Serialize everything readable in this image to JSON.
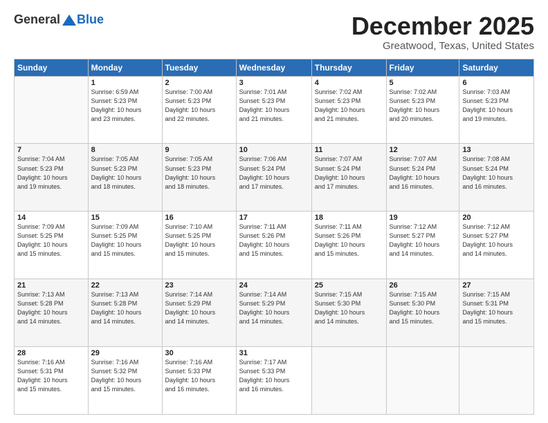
{
  "header": {
    "logo_general": "General",
    "logo_blue": "Blue",
    "month": "December 2025",
    "location": "Greatwood, Texas, United States"
  },
  "weekdays": [
    "Sunday",
    "Monday",
    "Tuesday",
    "Wednesday",
    "Thursday",
    "Friday",
    "Saturday"
  ],
  "weeks": [
    [
      {
        "day": "",
        "info": ""
      },
      {
        "day": "1",
        "info": "Sunrise: 6:59 AM\nSunset: 5:23 PM\nDaylight: 10 hours\nand 23 minutes."
      },
      {
        "day": "2",
        "info": "Sunrise: 7:00 AM\nSunset: 5:23 PM\nDaylight: 10 hours\nand 22 minutes."
      },
      {
        "day": "3",
        "info": "Sunrise: 7:01 AM\nSunset: 5:23 PM\nDaylight: 10 hours\nand 21 minutes."
      },
      {
        "day": "4",
        "info": "Sunrise: 7:02 AM\nSunset: 5:23 PM\nDaylight: 10 hours\nand 21 minutes."
      },
      {
        "day": "5",
        "info": "Sunrise: 7:02 AM\nSunset: 5:23 PM\nDaylight: 10 hours\nand 20 minutes."
      },
      {
        "day": "6",
        "info": "Sunrise: 7:03 AM\nSunset: 5:23 PM\nDaylight: 10 hours\nand 19 minutes."
      }
    ],
    [
      {
        "day": "7",
        "info": "Sunrise: 7:04 AM\nSunset: 5:23 PM\nDaylight: 10 hours\nand 19 minutes."
      },
      {
        "day": "8",
        "info": "Sunrise: 7:05 AM\nSunset: 5:23 PM\nDaylight: 10 hours\nand 18 minutes."
      },
      {
        "day": "9",
        "info": "Sunrise: 7:05 AM\nSunset: 5:23 PM\nDaylight: 10 hours\nand 18 minutes."
      },
      {
        "day": "10",
        "info": "Sunrise: 7:06 AM\nSunset: 5:24 PM\nDaylight: 10 hours\nand 17 minutes."
      },
      {
        "day": "11",
        "info": "Sunrise: 7:07 AM\nSunset: 5:24 PM\nDaylight: 10 hours\nand 17 minutes."
      },
      {
        "day": "12",
        "info": "Sunrise: 7:07 AM\nSunset: 5:24 PM\nDaylight: 10 hours\nand 16 minutes."
      },
      {
        "day": "13",
        "info": "Sunrise: 7:08 AM\nSunset: 5:24 PM\nDaylight: 10 hours\nand 16 minutes."
      }
    ],
    [
      {
        "day": "14",
        "info": "Sunrise: 7:09 AM\nSunset: 5:25 PM\nDaylight: 10 hours\nand 15 minutes."
      },
      {
        "day": "15",
        "info": "Sunrise: 7:09 AM\nSunset: 5:25 PM\nDaylight: 10 hours\nand 15 minutes."
      },
      {
        "day": "16",
        "info": "Sunrise: 7:10 AM\nSunset: 5:25 PM\nDaylight: 10 hours\nand 15 minutes."
      },
      {
        "day": "17",
        "info": "Sunrise: 7:11 AM\nSunset: 5:26 PM\nDaylight: 10 hours\nand 15 minutes."
      },
      {
        "day": "18",
        "info": "Sunrise: 7:11 AM\nSunset: 5:26 PM\nDaylight: 10 hours\nand 15 minutes."
      },
      {
        "day": "19",
        "info": "Sunrise: 7:12 AM\nSunset: 5:27 PM\nDaylight: 10 hours\nand 14 minutes."
      },
      {
        "day": "20",
        "info": "Sunrise: 7:12 AM\nSunset: 5:27 PM\nDaylight: 10 hours\nand 14 minutes."
      }
    ],
    [
      {
        "day": "21",
        "info": "Sunrise: 7:13 AM\nSunset: 5:28 PM\nDaylight: 10 hours\nand 14 minutes."
      },
      {
        "day": "22",
        "info": "Sunrise: 7:13 AM\nSunset: 5:28 PM\nDaylight: 10 hours\nand 14 minutes."
      },
      {
        "day": "23",
        "info": "Sunrise: 7:14 AM\nSunset: 5:29 PM\nDaylight: 10 hours\nand 14 minutes."
      },
      {
        "day": "24",
        "info": "Sunrise: 7:14 AM\nSunset: 5:29 PM\nDaylight: 10 hours\nand 14 minutes."
      },
      {
        "day": "25",
        "info": "Sunrise: 7:15 AM\nSunset: 5:30 PM\nDaylight: 10 hours\nand 14 minutes."
      },
      {
        "day": "26",
        "info": "Sunrise: 7:15 AM\nSunset: 5:30 PM\nDaylight: 10 hours\nand 15 minutes."
      },
      {
        "day": "27",
        "info": "Sunrise: 7:15 AM\nSunset: 5:31 PM\nDaylight: 10 hours\nand 15 minutes."
      }
    ],
    [
      {
        "day": "28",
        "info": "Sunrise: 7:16 AM\nSunset: 5:31 PM\nDaylight: 10 hours\nand 15 minutes."
      },
      {
        "day": "29",
        "info": "Sunrise: 7:16 AM\nSunset: 5:32 PM\nDaylight: 10 hours\nand 15 minutes."
      },
      {
        "day": "30",
        "info": "Sunrise: 7:16 AM\nSunset: 5:33 PM\nDaylight: 10 hours\nand 16 minutes."
      },
      {
        "day": "31",
        "info": "Sunrise: 7:17 AM\nSunset: 5:33 PM\nDaylight: 10 hours\nand 16 minutes."
      },
      {
        "day": "",
        "info": ""
      },
      {
        "day": "",
        "info": ""
      },
      {
        "day": "",
        "info": ""
      }
    ]
  ]
}
